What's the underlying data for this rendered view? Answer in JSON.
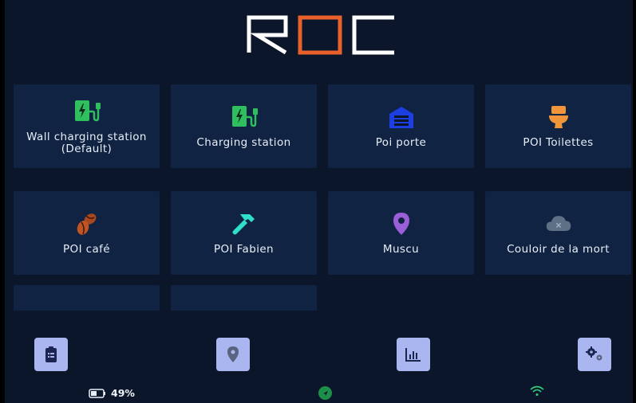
{
  "app": {
    "logo_text": "ROC"
  },
  "colors": {
    "background": "#0b162a",
    "tile": "#102342",
    "nav_button": "#aab6ef",
    "logo_white": "#ffffff",
    "logo_orange": "#e8612a"
  },
  "tiles": [
    {
      "label": "Wall charging station\n(Default)",
      "icon": "ev-charger-icon",
      "color": "#2fbf5f"
    },
    {
      "label": "Charging station",
      "icon": "ev-charger-icon",
      "color": "#2fbf5f"
    },
    {
      "label": "Poi porte",
      "icon": "garage-door-icon",
      "color": "#1b3fe0"
    },
    {
      "label": "POI Toilettes",
      "icon": "toilet-icon",
      "color": "#f0953a"
    },
    {
      "label": "POI café",
      "icon": "coffee-beans-icon",
      "color": "#b04a1f"
    },
    {
      "label": "POI Fabien",
      "icon": "hammer-icon",
      "color": "#2ee0c8"
    },
    {
      "label": "Muscu",
      "icon": "map-pin-icon",
      "color": "#9a5fd6"
    },
    {
      "label": "Couloir de la mort",
      "icon": "cloud-x-icon",
      "color": "#5d7086"
    },
    {
      "label": "",
      "icon": "partial-tile-icon",
      "color": "#b65a20"
    },
    {
      "label": "",
      "icon": "partial-tile-icon",
      "color": "#e0225a"
    }
  ],
  "bottom_nav": [
    {
      "name": "clipboard-icon"
    },
    {
      "name": "location-pin-icon"
    },
    {
      "name": "bar-chart-icon"
    },
    {
      "name": "settings-gears-icon"
    }
  ],
  "status": {
    "battery_percent": "49%",
    "compass_icon": "compass-icon",
    "wifi_icon": "wifi-icon"
  }
}
